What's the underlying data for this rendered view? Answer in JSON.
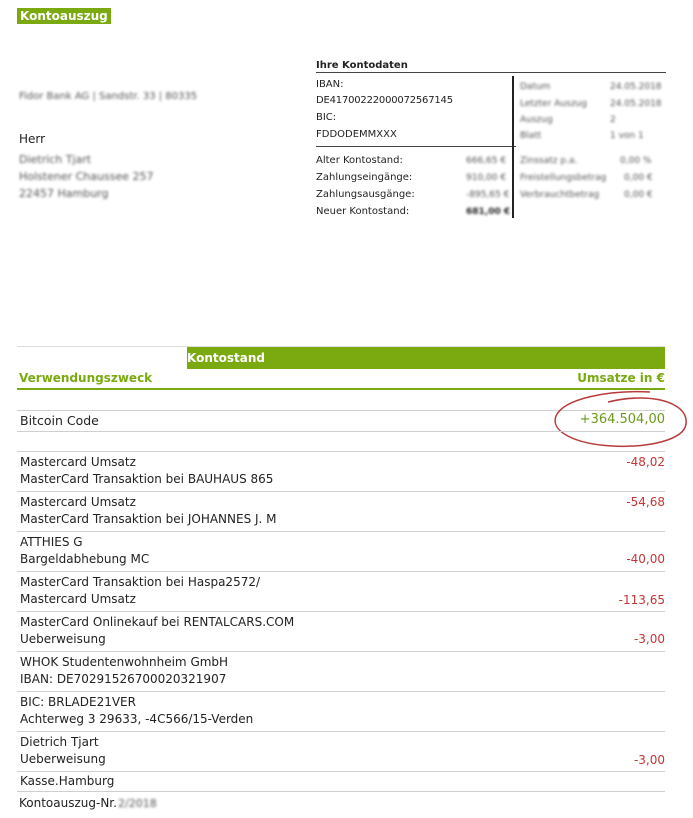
{
  "doc_title": "Kontoauszug",
  "sender_line": "Fidor Bank AG | Sandstr. 33 | 80335",
  "recipient": {
    "salutation": "Herr",
    "name": "Dietrich Tjart",
    "street": "Holstener Chaussee 257",
    "city": "22457 Hamburg"
  },
  "kontodaten": {
    "title": "Ihre Kontodaten",
    "iban_label": "IBAN:",
    "iban": "DE41700222000072567145",
    "bic_label": "BIC:",
    "bic": "FDDODEMMXXX",
    "alter_label": "Alter Kontostand:",
    "alter_value": "666,65 €",
    "eing_label": "Zahlungseingänge:",
    "eing_value": "910,00 €",
    "ausg_label": "Zahlungsausgänge:",
    "ausg_value": "-895,65 €",
    "neuer_label": "Neuer Kontostand:",
    "neuer_value": "681,00 €",
    "right_rows": [
      {
        "label": "Datum",
        "value": "24.05.2018"
      },
      {
        "label": "Letzter Auszug",
        "value": "24.05.2018"
      },
      {
        "label": "Auszug",
        "value": "2"
      },
      {
        "label": "Blatt",
        "value": "1 von 1"
      },
      {
        "label": "Zinssatz p.a.",
        "value": "0,00 %"
      },
      {
        "label": "Freistellungsbetrag",
        "value": "0,00 €"
      },
      {
        "label": "Verbrauchtbetrag",
        "value": "0,00 €"
      }
    ]
  },
  "table": {
    "band_label": "Kontostand",
    "col_left": "Verwendungszweck",
    "col_right": "Umsatze in €",
    "bitcoin_label": "Bitcoin Code",
    "bitcoin_amount": "+364.504,00",
    "rows": [
      {
        "line1": "Mastercard Umsatz",
        "line2": "MasterCard Transaktion bei BAUHAUS 865",
        "amount": "-48,02"
      },
      {
        "line1": "Mastercard Umsatz",
        "line2": "MasterCard Transaktion bei JOHANNES J. M",
        "amount": "-54,68"
      },
      {
        "line1": "ATTHIES G",
        "line2": "Bargeldabhebung MC",
        "amount": "-40,00"
      },
      {
        "line1": "MasterCard Transaktion bei Haspa2572/",
        "line2": "Mastercard Umsatz",
        "amount": "-113,65"
      },
      {
        "line1": "MasterCard Onlinekauf bei RENTALCARS.COM",
        "line2": "Ueberweisung",
        "amount": "-3,00"
      },
      {
        "line1": "WHOK Studentenwohnheim GmbH",
        "line2": "IBAN: DE70291526700020321907",
        "amount": ""
      },
      {
        "line1": "BIC: BRLADE21VER",
        "line2": "Achterweg 3 29633, -4C566/15-Verden",
        "amount": ""
      },
      {
        "line1": "Dietrich Tjart",
        "line2": "Ueberweisung",
        "amount": "-3,00"
      },
      {
        "line1": "Kasse.Hamburg",
        "line2": "",
        "amount": ""
      }
    ]
  },
  "footer": {
    "label": "Kontoauszug-Nr.",
    "value": "2/2018"
  },
  "colors": {
    "accent_green": "#7aaa10",
    "negative_red": "#c63535",
    "circle_red": "#b83a3a"
  }
}
